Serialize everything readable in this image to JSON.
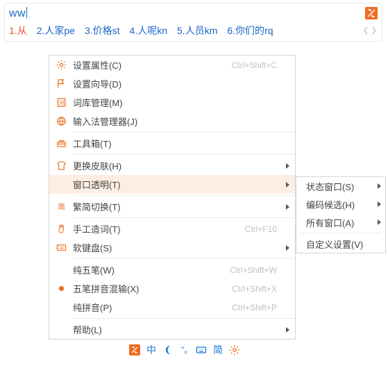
{
  "ime": {
    "input": "ww",
    "candidates": [
      {
        "n": "1.",
        "text": "从",
        "suffix": ""
      },
      {
        "n": "2.",
        "text": "人家",
        "suffix": "pe"
      },
      {
        "n": "3.",
        "text": "价格",
        "suffix": "st"
      },
      {
        "n": "4.",
        "text": "人呢",
        "suffix": "kn"
      },
      {
        "n": "5.",
        "text": "人员",
        "suffix": "km"
      },
      {
        "n": "6.",
        "text": "你们的",
        "suffix": "rq"
      }
    ]
  },
  "menu": {
    "items": [
      {
        "icon": "gear",
        "label": "设置属性(C)",
        "shortcut": "Ctrl+Shift+C"
      },
      {
        "icon": "flag",
        "label": "设置向导(D)"
      },
      {
        "icon": "dict",
        "label": "词库管理(M)"
      },
      {
        "icon": "globe",
        "label": "输入法管理器(J)"
      },
      {
        "sep": true
      },
      {
        "icon": "toolbox",
        "label": "工具箱(T)"
      },
      {
        "sep": true
      },
      {
        "icon": "shirt",
        "label": "更换皮肤(H)",
        "submenu": true
      },
      {
        "icon": "",
        "label": "窗口透明(T)",
        "submenu": true,
        "active": true
      },
      {
        "sep": true
      },
      {
        "icon": "simp",
        "label": "繁简切换(T)",
        "submenu": true
      },
      {
        "sep": true
      },
      {
        "icon": "hand",
        "label": "手工造词(T)",
        "shortcut": "Ctrl+F10"
      },
      {
        "icon": "keyboard",
        "label": "软键盘(S)",
        "submenu": true
      },
      {
        "sep": true
      },
      {
        "icon": "",
        "label": "纯五笔(W)",
        "shortcut": "Ctrl+Shift+W"
      },
      {
        "icon": "dot",
        "label": "五笔拼音混输(X)",
        "shortcut": "Ctrl+Shift+X"
      },
      {
        "icon": "",
        "label": "纯拼音(P)",
        "shortcut": "Ctrl+Shift+P"
      },
      {
        "sep": true
      },
      {
        "icon": "",
        "label": "帮助(L)",
        "submenu": true
      }
    ]
  },
  "submenu": {
    "items": [
      {
        "label": "状态窗口(S)",
        "submenu": true
      },
      {
        "label": "编码候选(H)",
        "submenu": true
      },
      {
        "label": "所有窗口(A)",
        "submenu": true
      },
      {
        "sep": true
      },
      {
        "label": "自定义设置(V)"
      }
    ]
  },
  "statusbar": {
    "items": [
      {
        "name": "logo-icon"
      },
      {
        "name": "cn-indicator",
        "text": "中"
      },
      {
        "name": "moon-icon"
      },
      {
        "name": "punct-icon"
      },
      {
        "name": "keyboard-icon"
      },
      {
        "name": "simp-indicator",
        "text": "简"
      },
      {
        "name": "settings-icon"
      }
    ]
  }
}
